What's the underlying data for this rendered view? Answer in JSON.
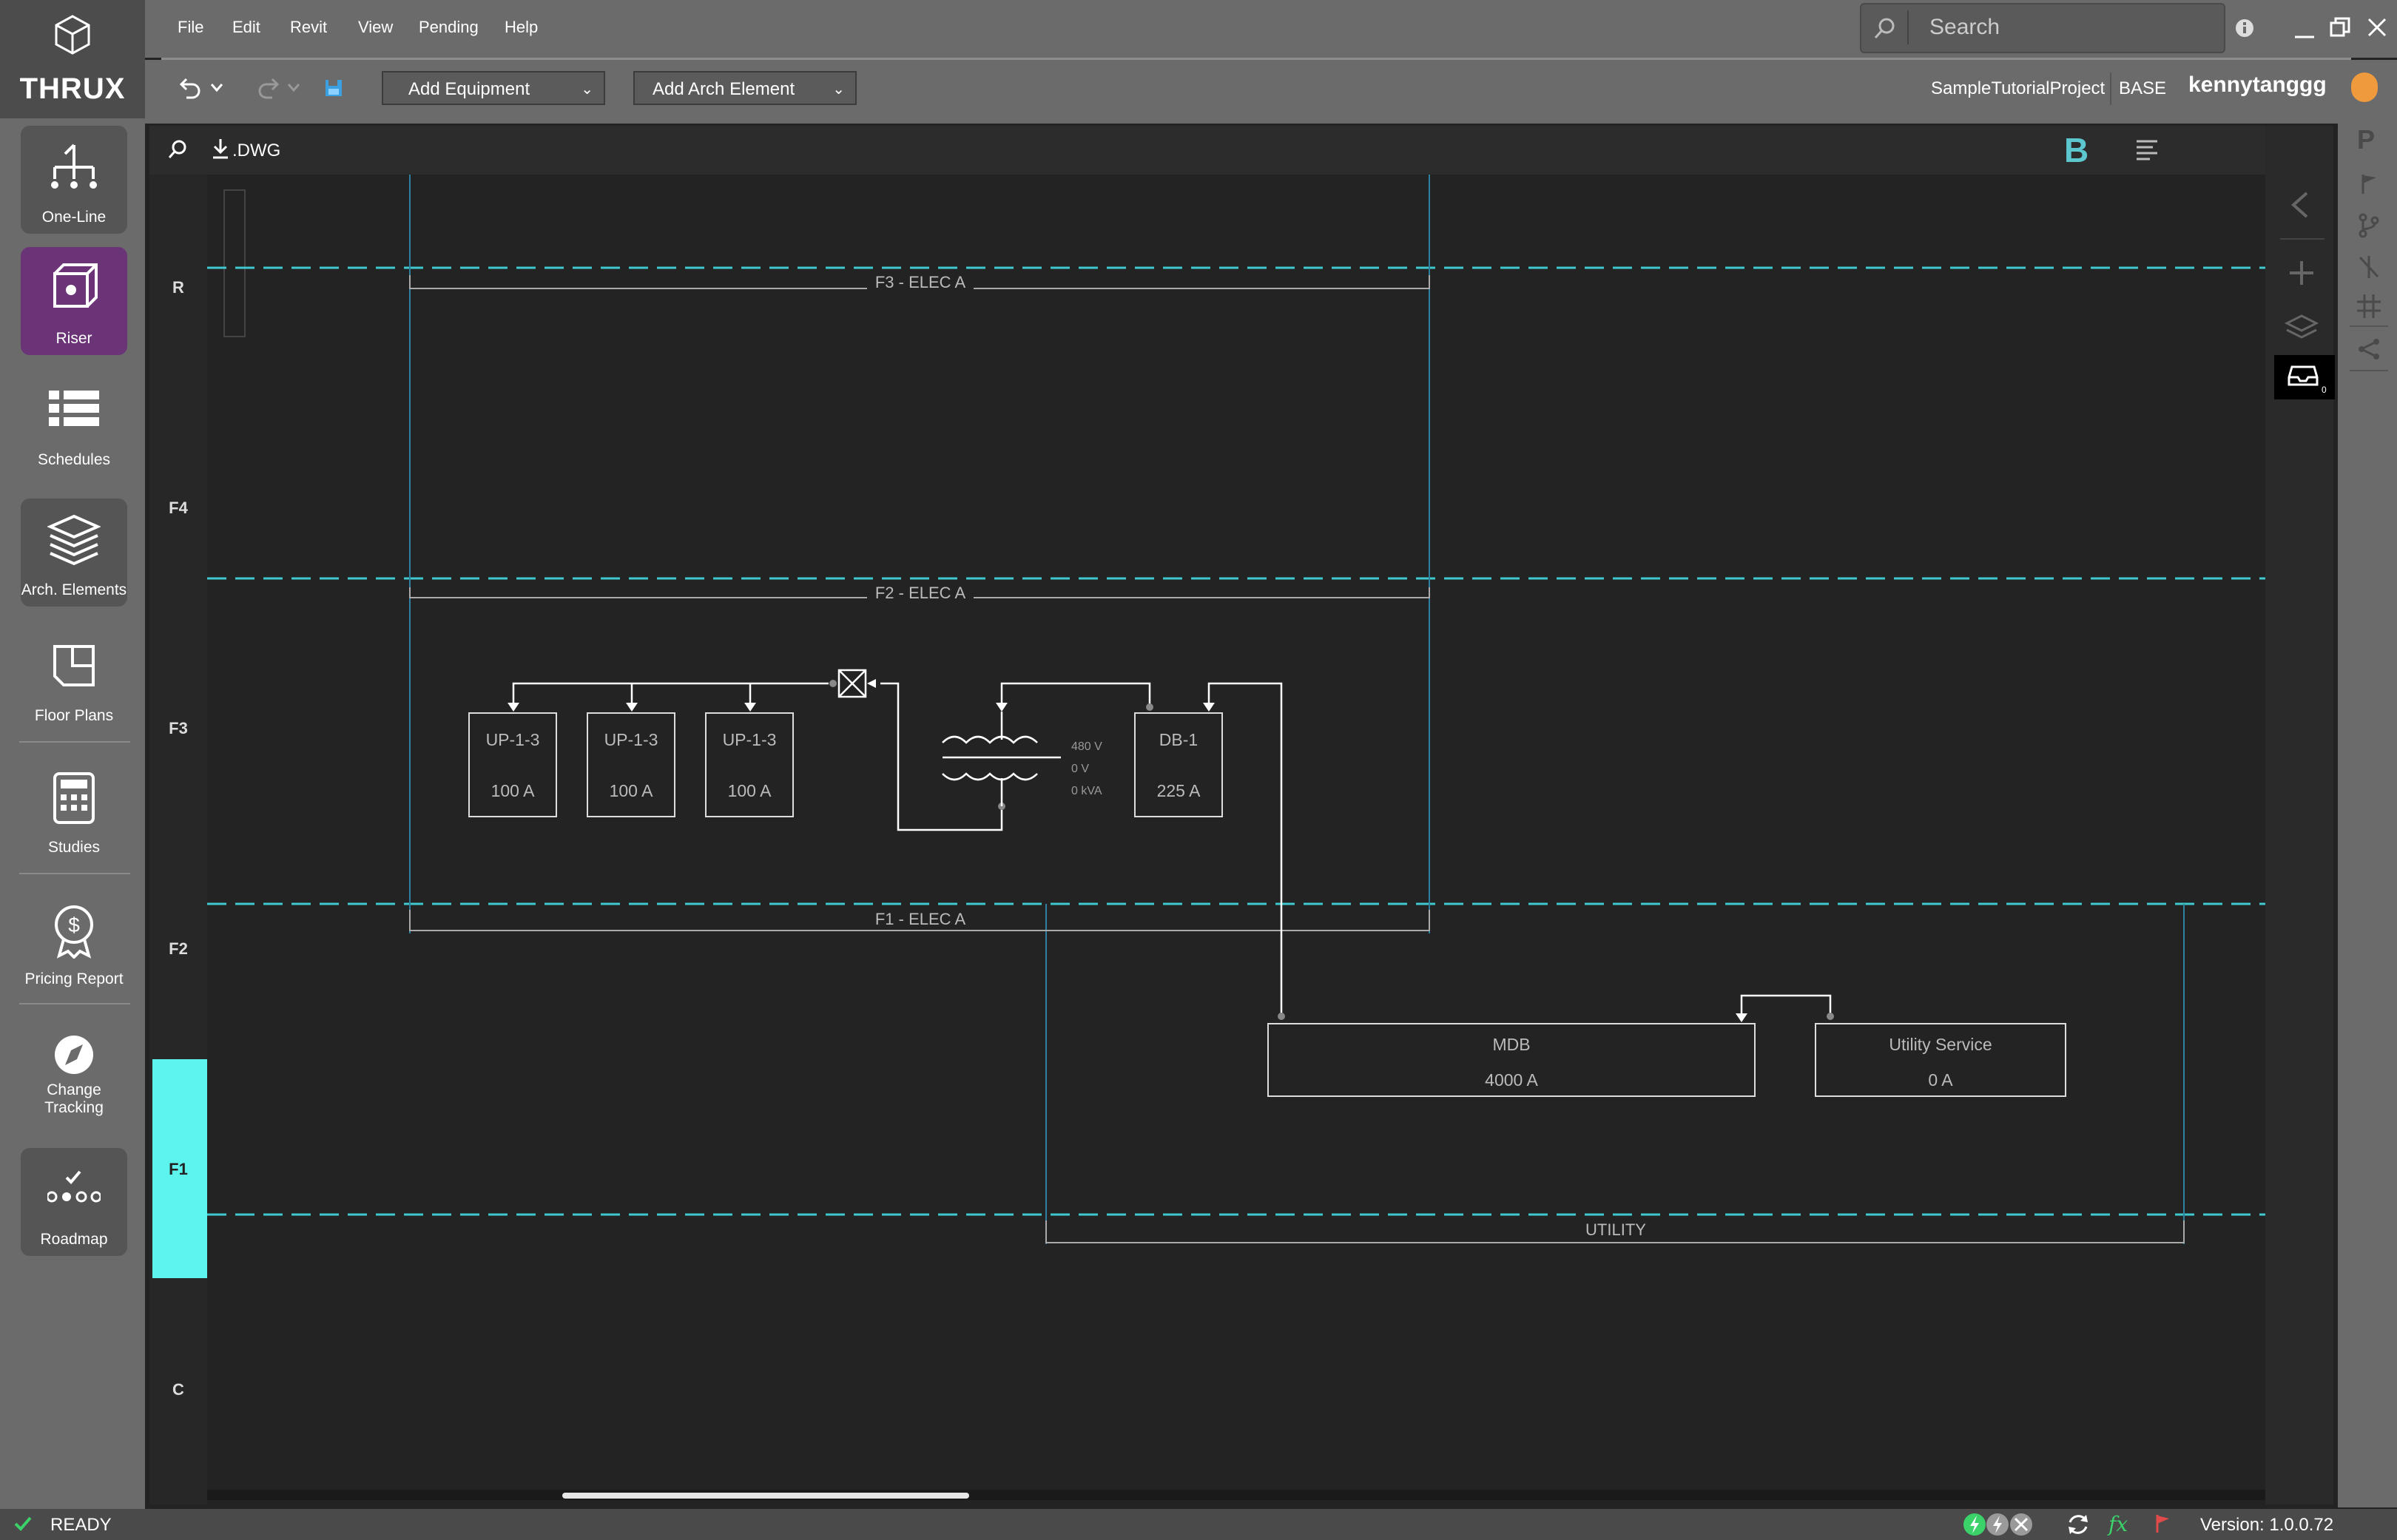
{
  "app": {
    "logo": "THRUX"
  },
  "menus": [
    "File",
    "Edit",
    "Revit",
    "View",
    "Pending",
    "Help"
  ],
  "toolbar": {
    "add_equipment": "Add Equipment",
    "add_arch": "Add Arch Element"
  },
  "search": {
    "placeholder": "Search"
  },
  "project": {
    "name": "SampleTutorialProject",
    "branch": "BASE",
    "user": "kennytanggg"
  },
  "canvas_header": {
    "export_label": ".DWG",
    "bold_label": "B"
  },
  "nav": [
    {
      "label": "One-Line"
    },
    {
      "label": "Riser"
    },
    {
      "label": "Schedules"
    },
    {
      "label": "Arch. Elements"
    },
    {
      "label": "Floor Plans"
    },
    {
      "label": "Studies"
    },
    {
      "label": "Pricing Report"
    },
    {
      "label": "Change Tracking"
    },
    {
      "label": "Roadmap"
    }
  ],
  "levels": [
    "R",
    "F4",
    "F3",
    "F2",
    "F1",
    "C"
  ],
  "rooms": [
    "F3 - ELEC A",
    "F2 - ELEC A",
    "F1 - ELEC A",
    "UTILITY"
  ],
  "equipment": {
    "up1": {
      "name": "UP-1-3",
      "rating": "100 A"
    },
    "up2": {
      "name": "UP-1-3",
      "rating": "100 A"
    },
    "up3": {
      "name": "UP-1-3",
      "rating": "100 A"
    },
    "db1": {
      "name": "DB-1",
      "rating": "225 A"
    },
    "mdb": {
      "name": "MDB",
      "rating": "4000 A"
    },
    "utility": {
      "name": "Utility Service",
      "rating": "0 A"
    }
  },
  "transformer": {
    "voltage": "480 V",
    "secondary": "0 V",
    "kva": "0 kVA"
  },
  "inbox_count": "0",
  "status": {
    "text": "READY",
    "version": "Version: 1.0.0.72"
  },
  "colors": {
    "accent": "#5cf4ec",
    "riser_active": "#6a3477",
    "level_line": "#3ec9cf"
  }
}
